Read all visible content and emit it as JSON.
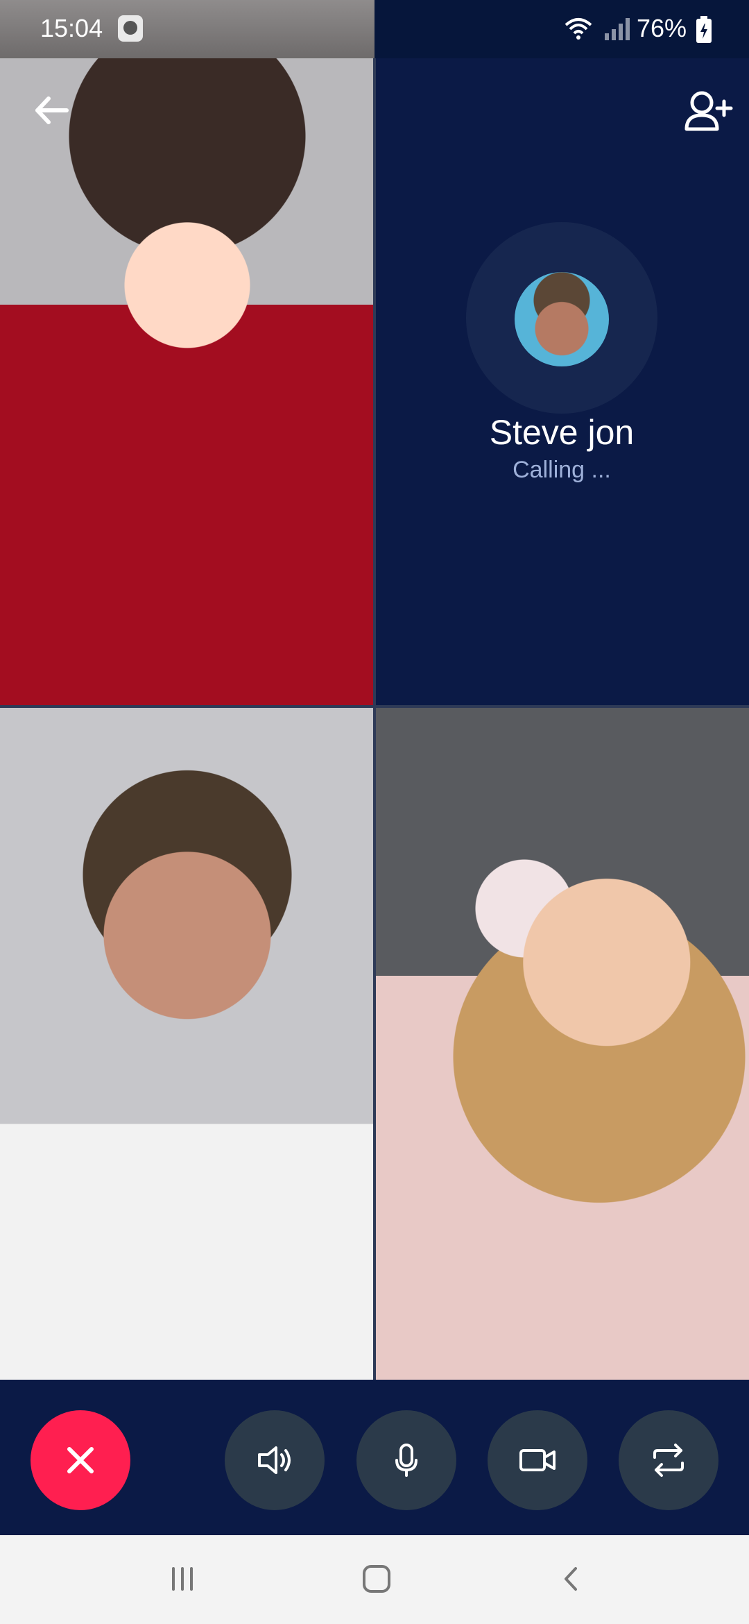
{
  "status_bar": {
    "time": "15:04",
    "battery": "76%"
  },
  "call": {
    "caller_name": "Steve jon",
    "caller_status": "Calling ..."
  },
  "colors": {
    "background": "#0b1a46",
    "end_call": "#ff1f50",
    "control_button": "#2b3a4a",
    "caller_status": "#9eb0d9"
  },
  "icons": {
    "back": "arrow-left-icon",
    "add_user": "add-user-icon",
    "end_call": "close-icon",
    "speaker": "speaker-icon",
    "mic": "microphone-icon",
    "camera": "video-camera-icon",
    "switch": "switch-camera-icon",
    "nav_recent": "recent-apps-icon",
    "nav_home": "home-icon",
    "nav_back": "back-chevron-icon"
  }
}
